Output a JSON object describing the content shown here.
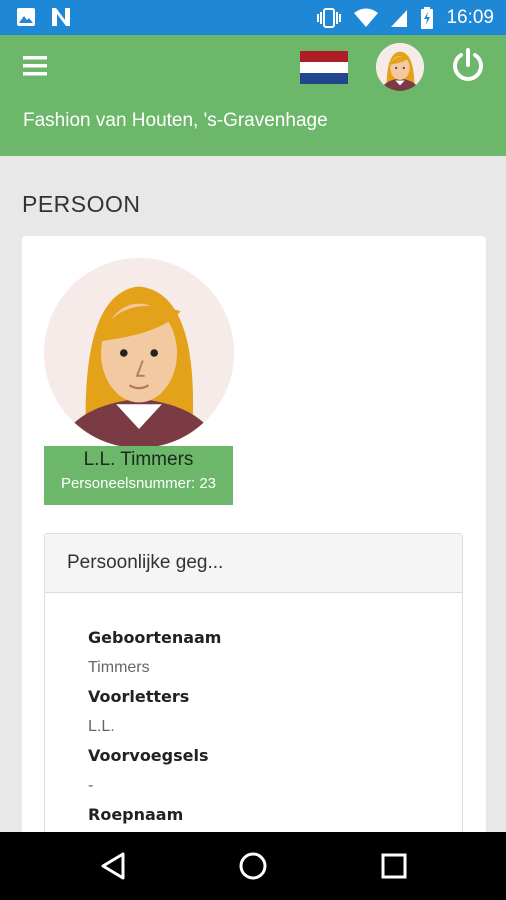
{
  "status_bar": {
    "time": "16:09",
    "icons": [
      "image-icon",
      "n-icon",
      "vibrate-icon",
      "wifi-icon",
      "signal-icon",
      "battery-icon"
    ]
  },
  "header": {
    "store_name": "Fashion van Houten, 's-Gravenhage",
    "flag_colors": [
      "#ae1c28",
      "#ffffff",
      "#21468b"
    ],
    "accent_color": "#6cb76a",
    "status_bar_color": "#1e88d6"
  },
  "page": {
    "title": "PERSOON"
  },
  "person": {
    "name": "L.L. Timmers",
    "employee_number": "Personeelsnummer: 23"
  },
  "panel": {
    "title": "Persoonlijke geg...",
    "fields": [
      {
        "label": "Geboortenaam",
        "value": "Timmers"
      },
      {
        "label": "Voorletters",
        "value": "L.L."
      },
      {
        "label": "Voorvoegsels",
        "value": "-"
      },
      {
        "label": "Roepnaam",
        "value": ""
      }
    ]
  },
  "nav": {
    "buttons": [
      "back-icon",
      "home-icon",
      "recents-icon"
    ]
  }
}
